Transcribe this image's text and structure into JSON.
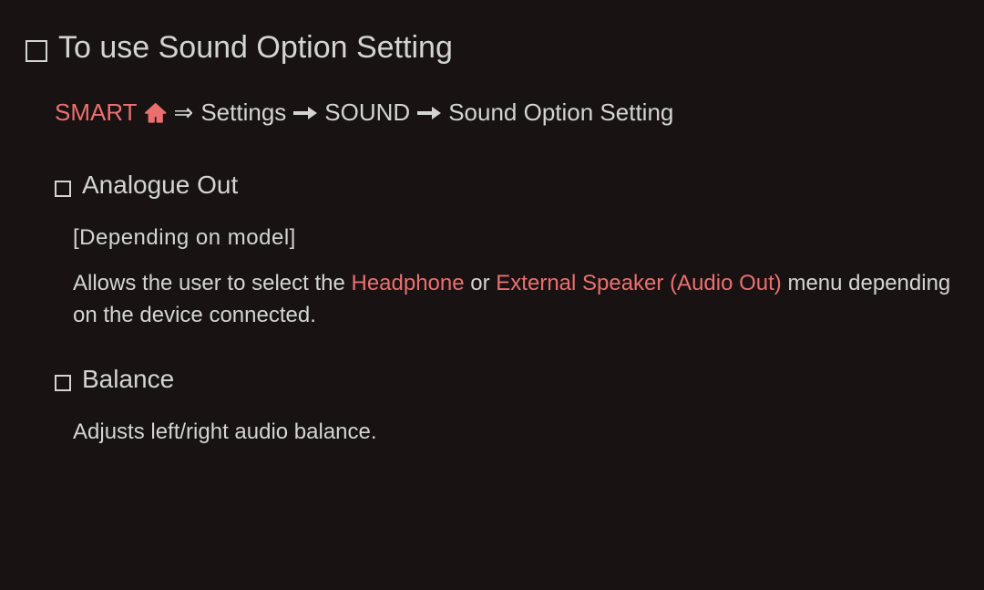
{
  "title": "To use Sound Option Setting",
  "breadcrumb": {
    "smart": "SMART",
    "settings": "Settings",
    "sound": "SOUND",
    "sound_option": "Sound Option Setting"
  },
  "sections": {
    "analogue": {
      "title": "Analogue Out",
      "note": "[Depending on model]",
      "desc_pre": "Allows the user to select the ",
      "opt1": "Headphone",
      "desc_or": " or ",
      "opt2": "External Speaker (Audio Out)",
      "desc_post": " menu depending on the device connected."
    },
    "balance": {
      "title": "Balance",
      "desc": "Adjusts left/right audio balance."
    }
  }
}
